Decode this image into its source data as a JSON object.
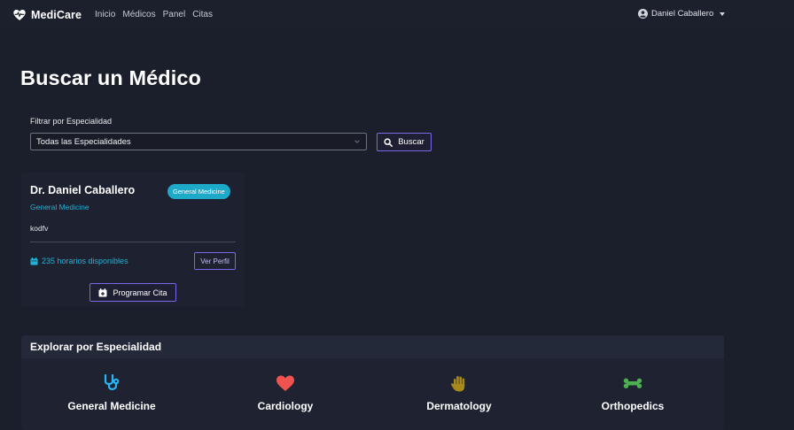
{
  "navbar": {
    "brand": "MediCare",
    "links": [
      "Inicio",
      "Médicos",
      "Panel",
      "Citas"
    ],
    "user": "Daniel Caballero"
  },
  "page": {
    "title": "Buscar un Médico"
  },
  "filter": {
    "label": "Filtrar por Especialidad",
    "selected": "Todas las Especialidades",
    "button": "Buscar"
  },
  "doctor_card": {
    "name": "Dr. Daniel Caballero",
    "badge": "General Medicine",
    "specialty": "General Medicine",
    "description": "kodfv",
    "availability": "235 horarios disponibles",
    "profile_button": "Ver Perfil",
    "schedule_button": "Programar Cita"
  },
  "explore": {
    "title": "Explorar por Especialidad",
    "items": [
      {
        "label": "General Medicine",
        "icon": "stethoscope-icon",
        "color": "#29b6f6"
      },
      {
        "label": "Cardiology",
        "icon": "heart-icon",
        "color": "#ef5350"
      },
      {
        "label": "Dermatology",
        "icon": "hand-icon",
        "color": "#a88a1c"
      },
      {
        "label": "Orthopedics",
        "icon": "bone-icon",
        "color": "#4caf50"
      }
    ]
  },
  "colors": {
    "background": "#1b1f2c",
    "accent": "#7b68e6",
    "info": "#23b2d6"
  }
}
